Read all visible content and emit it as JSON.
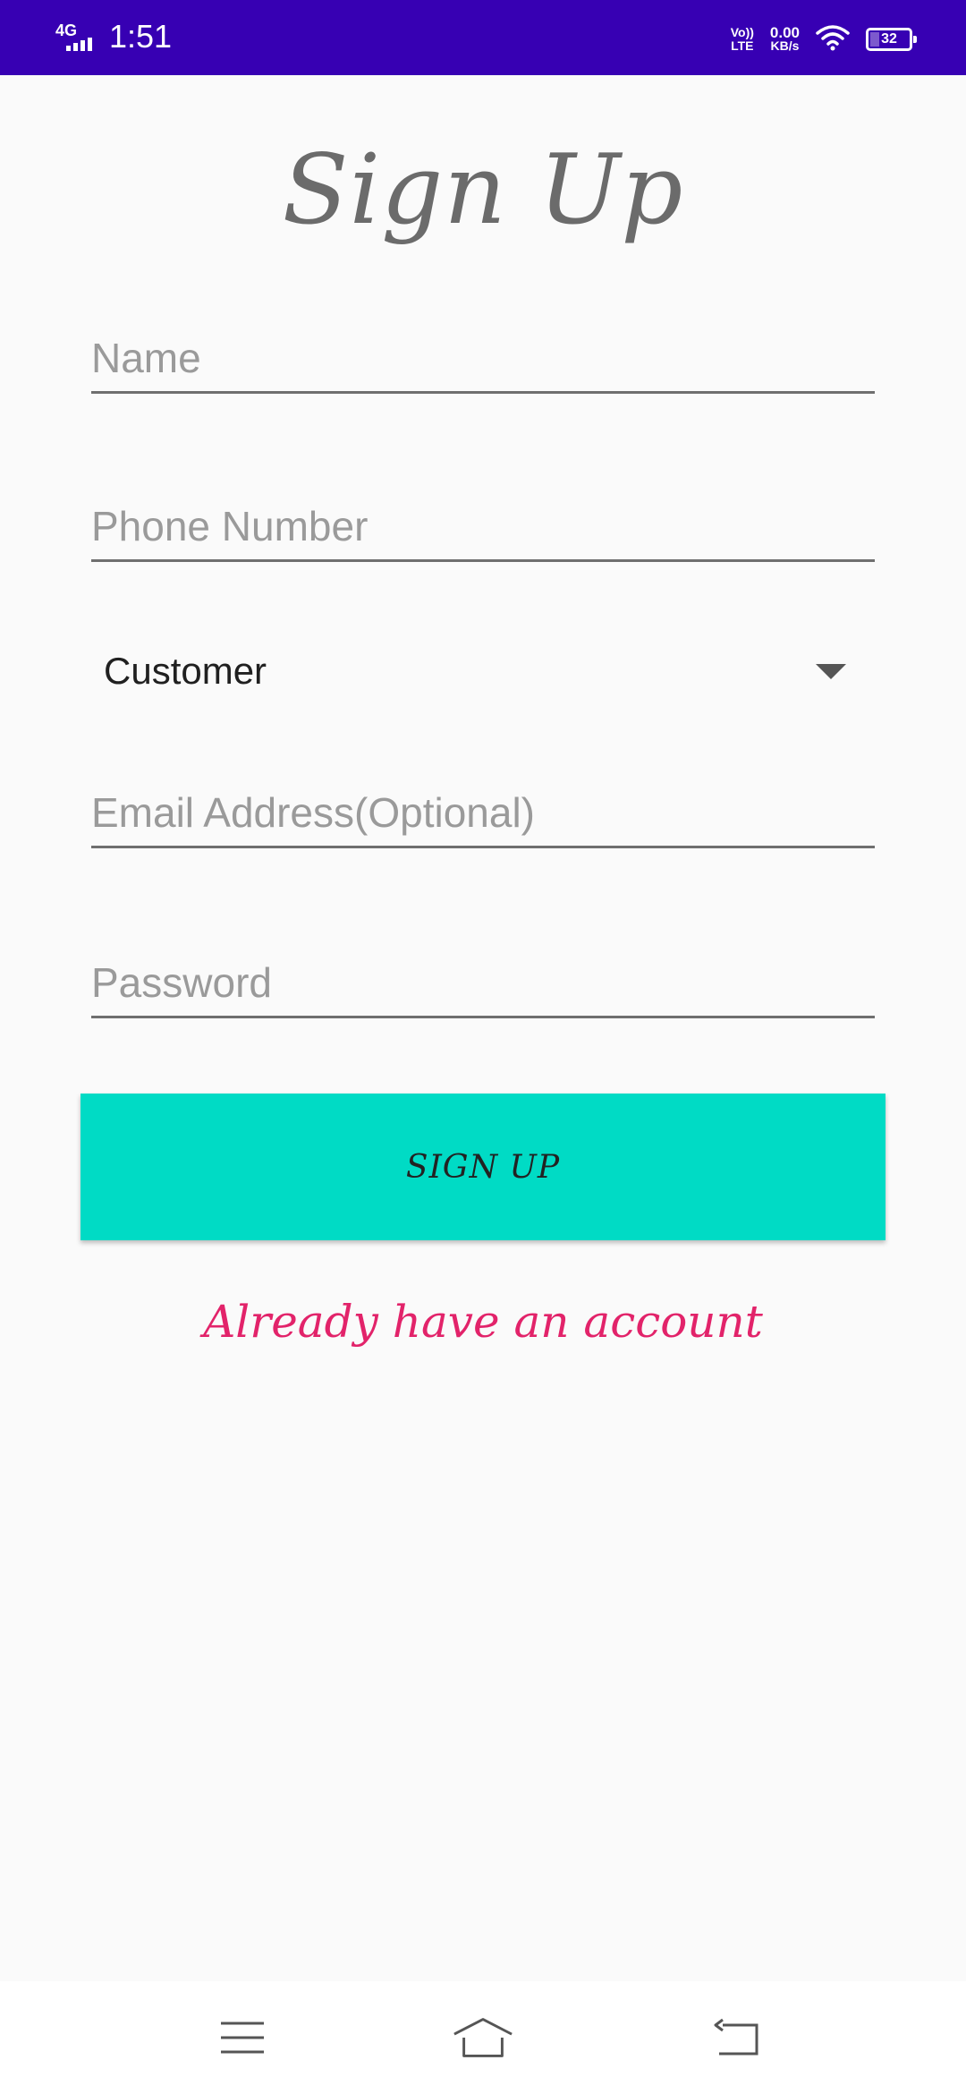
{
  "status_bar": {
    "network": "4G",
    "time": "1:51",
    "volte_top": "Vo))",
    "volte_bottom": "LTE",
    "speed_value": "0.00",
    "speed_unit": "KB/s",
    "battery": "32"
  },
  "title": "Sign Up",
  "form": {
    "name_placeholder": "Name",
    "phone_placeholder": "Phone Number",
    "role_selected": "Customer",
    "email_placeholder": "Email Address(Optional)",
    "password_placeholder": "Password"
  },
  "signup_button": "SIGN UP",
  "already_link": "Already have an account",
  "colors": {
    "status_bar": "#3700b3",
    "button": "#00dbc5",
    "link": "#e2236a",
    "title": "#6b6b6b"
  },
  "icons": {
    "nav": [
      "menu-icon",
      "home-icon",
      "back-icon"
    ],
    "status": [
      "signal-icon",
      "wifi-icon",
      "battery-icon"
    ]
  }
}
